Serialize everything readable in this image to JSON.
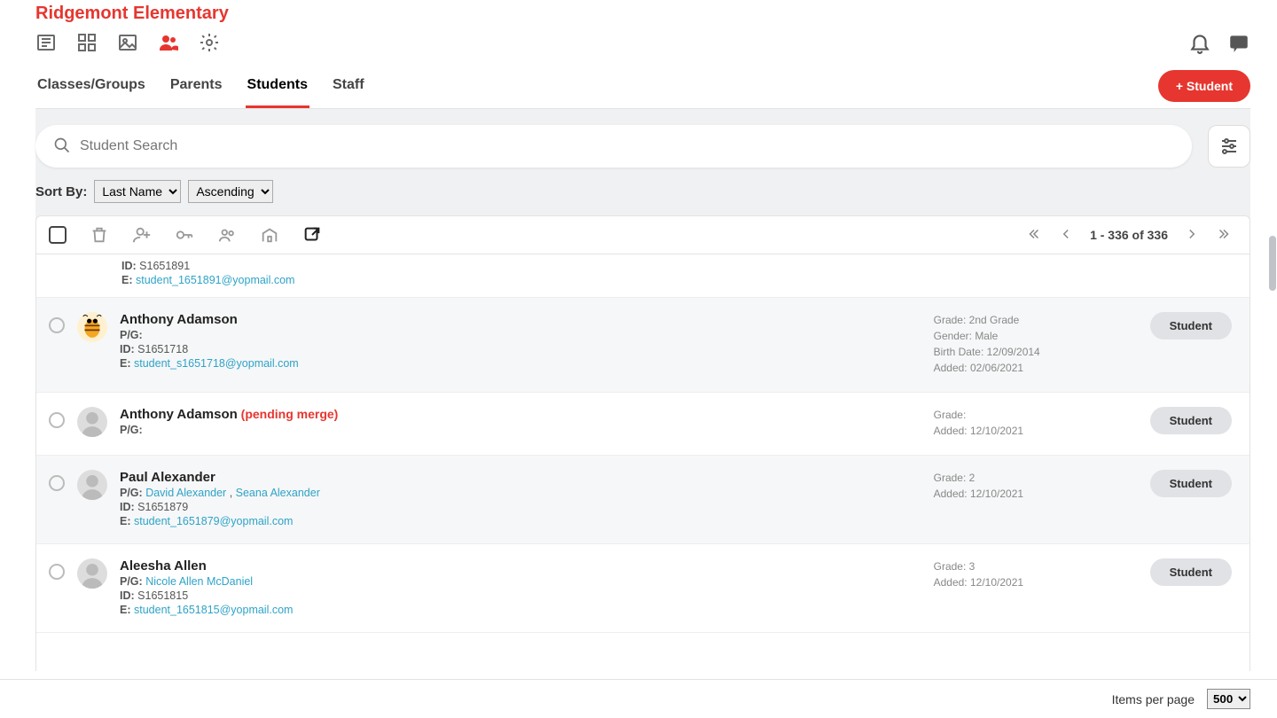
{
  "school_name": "Ridgemont Elementary",
  "tabs": [
    {
      "label": "Classes/Groups"
    },
    {
      "label": "Parents"
    },
    {
      "label": "Students"
    },
    {
      "label": "Staff"
    }
  ],
  "add_button": "+ Student",
  "search": {
    "placeholder": "Student Search"
  },
  "sort": {
    "label": "Sort By:",
    "field_options": [
      "Last Name"
    ],
    "field_selected": "Last Name",
    "direction_options": [
      "Ascending"
    ],
    "direction_selected": "Ascending"
  },
  "pagination": {
    "range": "1 - 336 of 336"
  },
  "partial_row": {
    "id_label": "ID:",
    "id": "S1651891",
    "email_label": "E:",
    "email": "student_1651891@yopmail.com"
  },
  "rows": [
    {
      "name": "Anthony Adamson",
      "pg_label": "P/G:",
      "pg": "",
      "id_label": "ID:",
      "id": "S1651718",
      "email_label": "E:",
      "email": "student_s1651718@yopmail.com",
      "grade_label": "Grade:",
      "grade": "2nd Grade",
      "gender_label": "Gender:",
      "gender": "Male",
      "birth_label": "Birth Date:",
      "birth": "12/09/2014",
      "added_label": "Added:",
      "added": "02/06/2021",
      "role": "Student",
      "avatar": "bee",
      "alt": true
    },
    {
      "name": "Anthony Adamson",
      "pending": "(pending merge)",
      "pg_label": "P/G:",
      "pg": "",
      "grade_label": "Grade:",
      "grade": "",
      "added_label": "Added:",
      "added": "12/10/2021",
      "role": "Student",
      "avatar": "blank"
    },
    {
      "name": "Paul Alexander",
      "pg_label": "P/G:",
      "pg_links": [
        "David Alexander",
        "Seana Alexander"
      ],
      "pg_sep": " , ",
      "id_label": "ID:",
      "id": "S1651879",
      "email_label": "E:",
      "email": "student_1651879@yopmail.com",
      "grade_label": "Grade:",
      "grade": "2",
      "added_label": "Added:",
      "added": "12/10/2021",
      "role": "Student",
      "avatar": "blank",
      "alt": true
    },
    {
      "name": "Aleesha Allen",
      "pg_label": "P/G:",
      "pg_links": [
        "Nicole Allen McDaniel"
      ],
      "id_label": "ID:",
      "id": "S1651815",
      "email_label": "E:",
      "email": "student_1651815@yopmail.com",
      "grade_label": "Grade:",
      "grade": "3",
      "added_label": "Added:",
      "added": "12/10/2021",
      "role": "Student",
      "avatar": "blank"
    }
  ],
  "footer": {
    "label": "Items per page",
    "options": [
      "500"
    ],
    "selected": "500"
  }
}
